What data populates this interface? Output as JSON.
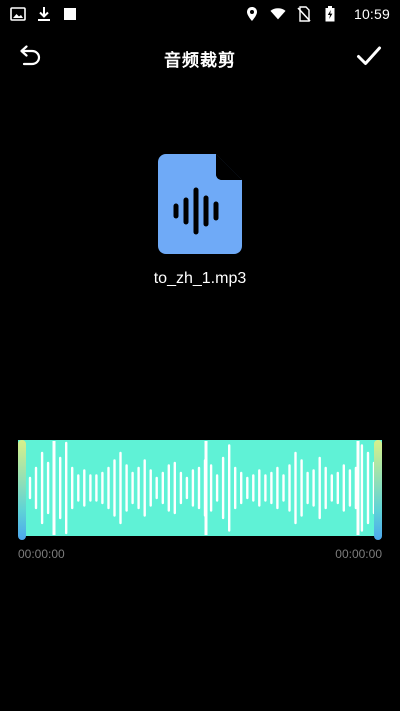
{
  "status_bar": {
    "time": "10:59",
    "left_icons": [
      "image-icon",
      "download-icon",
      "square-icon"
    ],
    "right_icons": [
      "location-icon",
      "wifi-icon",
      "no-sim-icon",
      "battery-charging-icon"
    ]
  },
  "toolbar": {
    "title": "音频裁剪",
    "back_icon": "undo-icon",
    "confirm_icon": "check-icon"
  },
  "file": {
    "icon": "audio-file-icon",
    "name": "to_zh_1.mp3",
    "icon_color": "#6faaf7"
  },
  "waveform": {
    "color": "#5ff2d6",
    "start_time": "00:00:00",
    "end_time": "00:00:00"
  }
}
